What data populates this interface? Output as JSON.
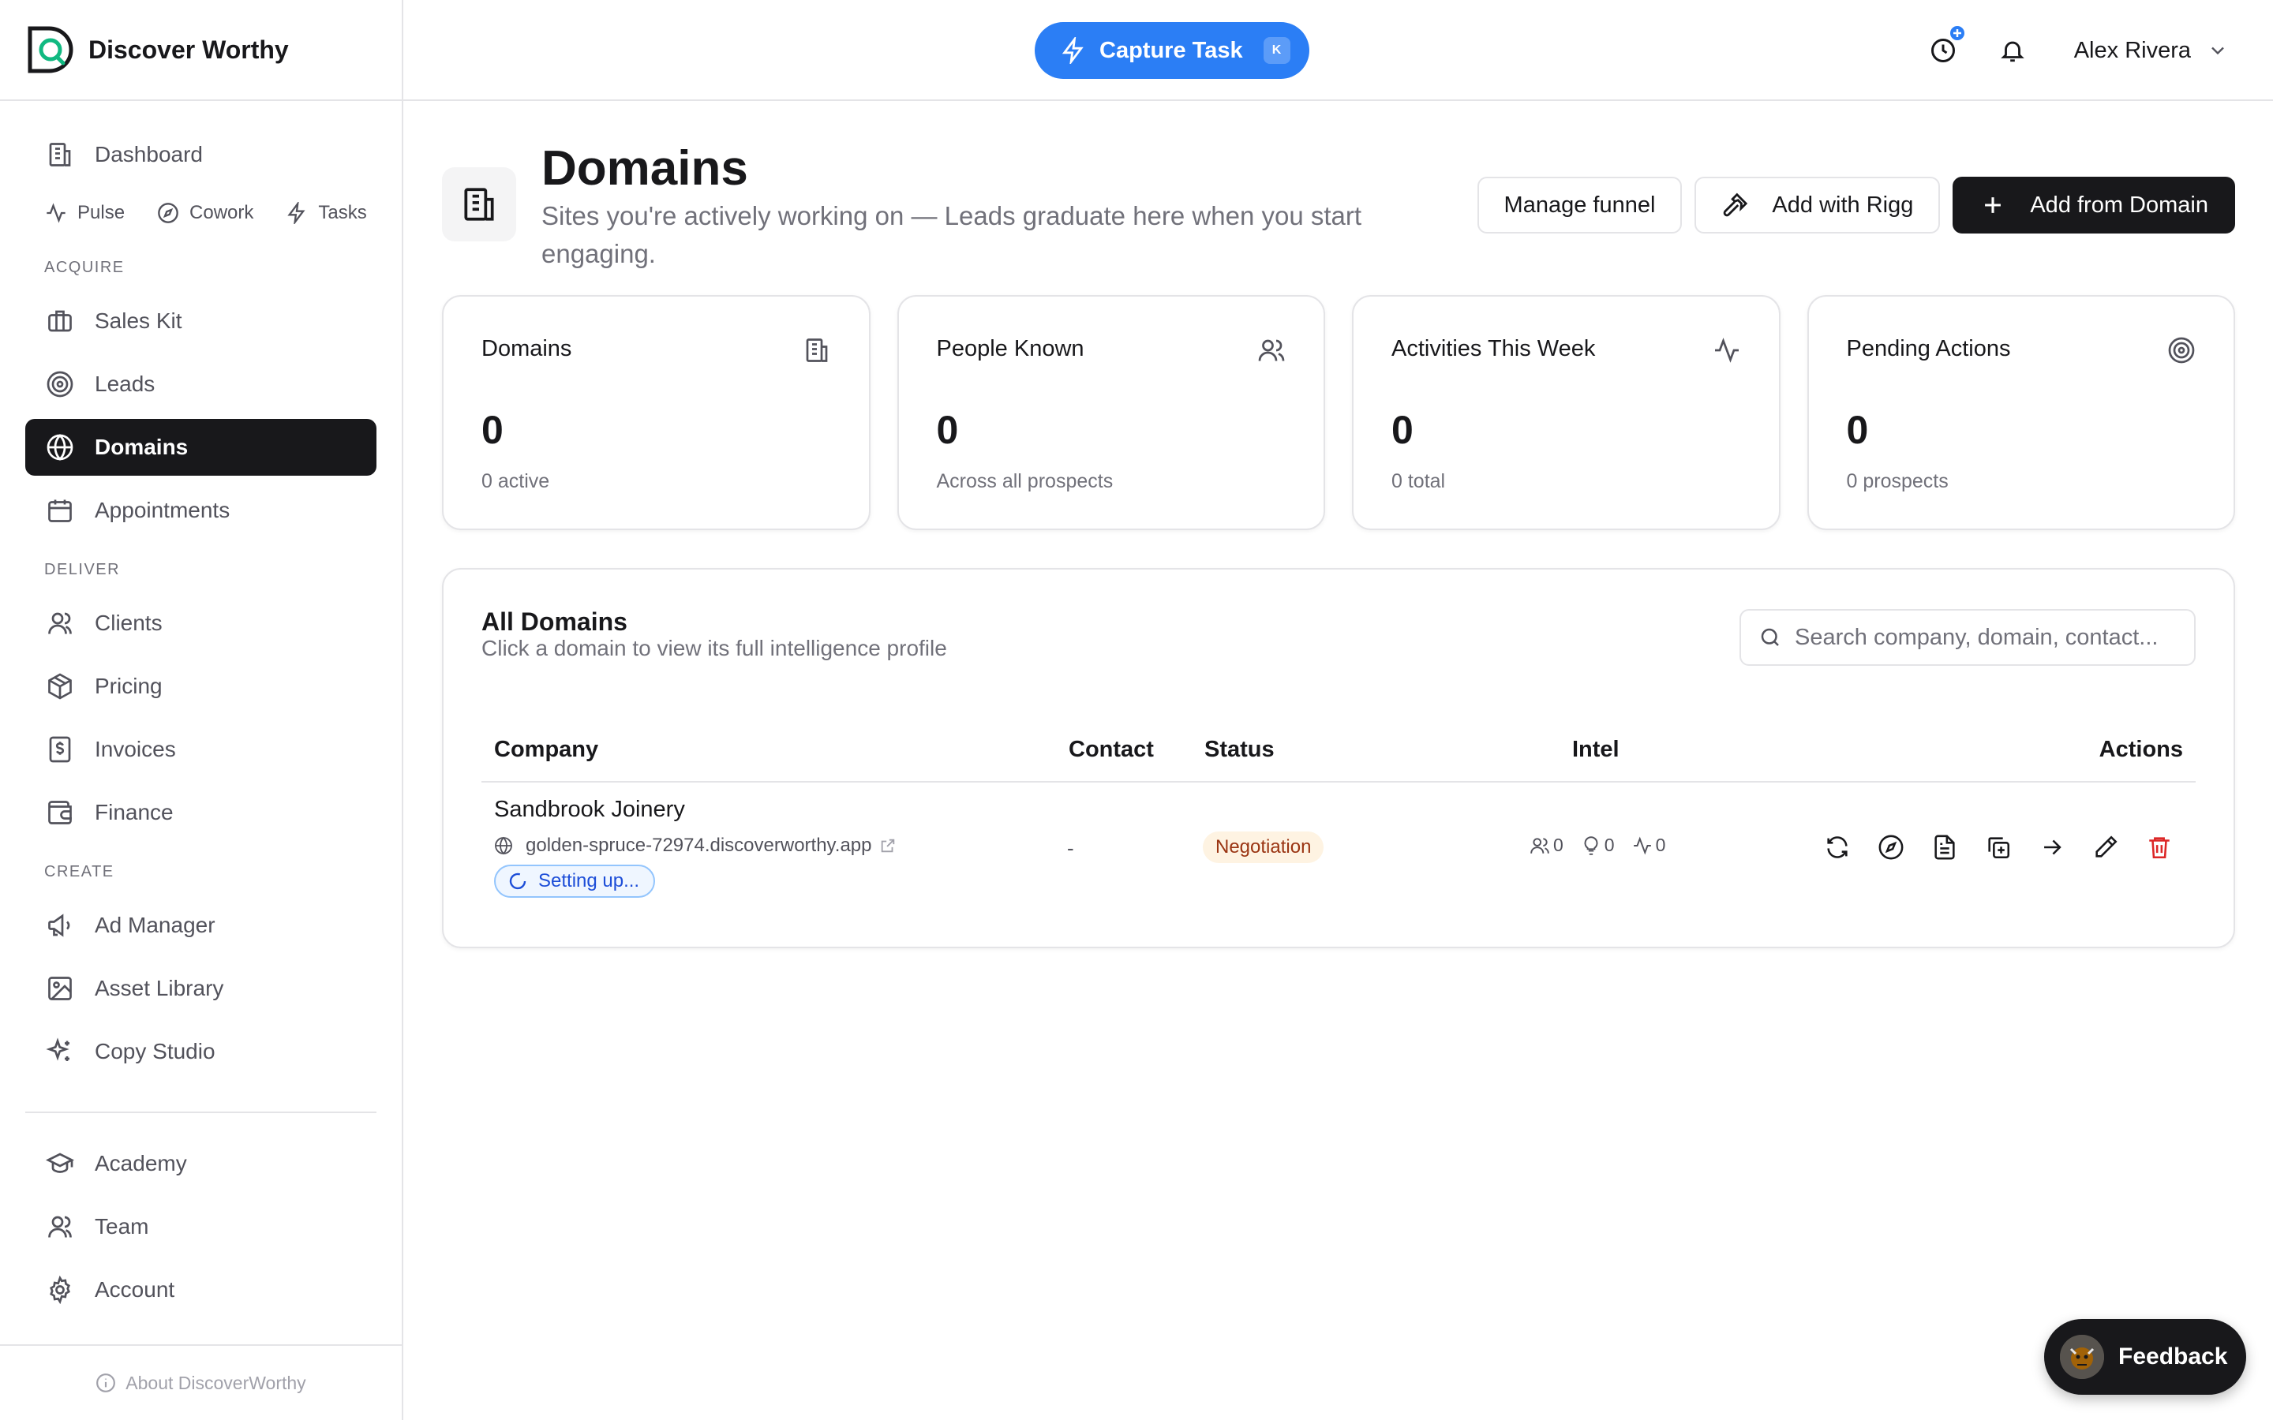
{
  "app": {
    "brand_name": "Discover Worthy"
  },
  "sidebar": {
    "dashboard": "Dashboard",
    "sub_items": [
      "Pulse",
      "Cowork",
      "Tasks"
    ],
    "sections": {
      "acquire": "ACQUIRE",
      "deliver": "DELIVER",
      "create": "CREATE"
    },
    "acquire_items": [
      "Sales Kit",
      "Leads",
      "Domains",
      "Appointments"
    ],
    "deliver_items": [
      "Clients",
      "Pricing",
      "Invoices",
      "Finance"
    ],
    "create_items": [
      "Ad Manager",
      "Asset Library",
      "Copy Studio"
    ],
    "bottom_items": [
      "Academy",
      "Team",
      "Account"
    ],
    "about": "About DiscoverWorthy",
    "active": "Domains"
  },
  "header": {
    "capture_label": "Capture Task",
    "capture_shortcut": "K",
    "user_name": "Alex Rivera"
  },
  "page": {
    "title": "Domains",
    "subtitle": "Sites you're actively working on — Leads graduate here when you start engaging.",
    "manage_funnel": "Manage funnel",
    "add_with_rigg": "Add with Rigg",
    "add_from_domain": "Add from Domain"
  },
  "stats": [
    {
      "label": "Domains",
      "value": "0",
      "sub": "0 active",
      "icon": "building-icon"
    },
    {
      "label": "People Known",
      "value": "0",
      "sub": "Across all prospects",
      "icon": "users-icon"
    },
    {
      "label": "Activities This Week",
      "value": "0",
      "sub": "0 total",
      "icon": "activity-icon"
    },
    {
      "label": "Pending Actions",
      "value": "0",
      "sub": "0 prospects",
      "icon": "target-icon"
    }
  ],
  "domains_panel": {
    "title": "All Domains",
    "subtitle": "Click a domain to view its full intelligence profile",
    "search_placeholder": "Search company, domain, contact...",
    "columns": [
      "Company",
      "Contact",
      "Status",
      "Intel",
      "Actions"
    ],
    "rows": [
      {
        "company": "Sandbrook Joinery",
        "domain": "golden-spruce-72974.discoverworthy.app",
        "setup_status": "Setting up...",
        "contact": "-",
        "status": "Negotiation",
        "intel_people": "0",
        "intel_ideas": "0",
        "intel_activity": "0"
      }
    ]
  },
  "feedback": {
    "label": "Feedback"
  },
  "colors": {
    "accent": "#2b7ef5",
    "active_nav": "#18181b",
    "status_negotiation_bg": "#fef3e2",
    "status_negotiation_text": "#9a3412",
    "delete": "#dc2626"
  }
}
